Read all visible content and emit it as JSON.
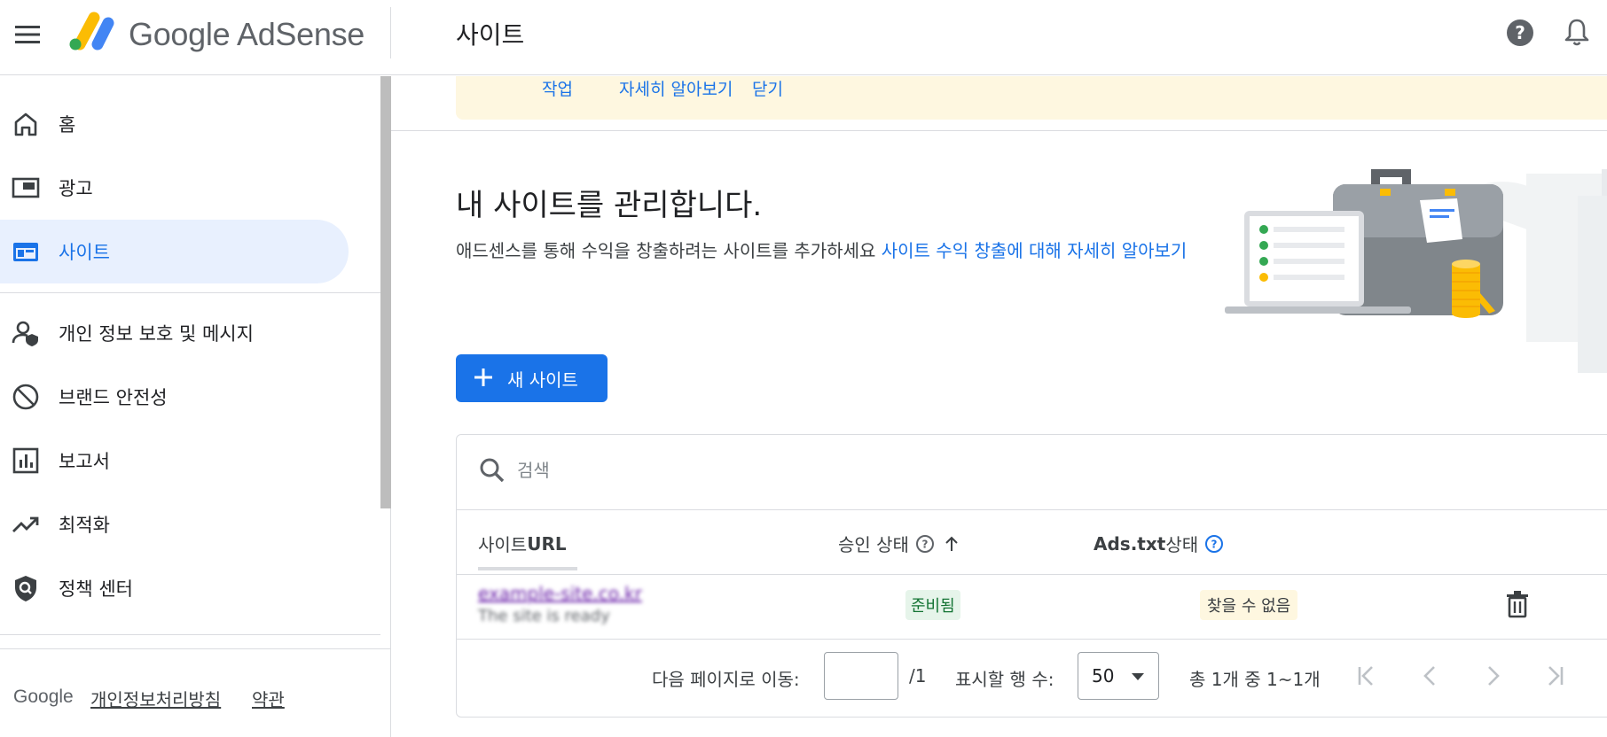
{
  "app": {
    "logo_text": "Google AdSense",
    "page_title": "사이트"
  },
  "topbar": {
    "menu_icon": "menu-icon",
    "help_icon": "help-icon",
    "notifications_icon": "bell-icon"
  },
  "sidebar": {
    "items": [
      {
        "label": "홈",
        "icon": "home-icon"
      },
      {
        "label": "광고",
        "icon": "ads-icon"
      },
      {
        "label": "사이트",
        "icon": "sites-icon",
        "active": true
      },
      {
        "label": "개인 정보 보호 및 메시지",
        "icon": "privacy-icon"
      },
      {
        "label": "브랜드 안전성",
        "icon": "block-icon"
      },
      {
        "label": "보고서",
        "icon": "reports-icon"
      },
      {
        "label": "최적화",
        "icon": "trending-up-icon"
      },
      {
        "label": "정책 센터",
        "icon": "policy-icon"
      }
    ],
    "footer": {
      "brand": "Google",
      "privacy": "개인정보처리방침",
      "terms": "약관"
    }
  },
  "banner": {
    "action": "작업",
    "learn_more": "자세히 알아보기",
    "close": "닫기"
  },
  "main": {
    "heading": "내 사이트를 관리합니다.",
    "description": "애드센스를 통해 수익을 창출하려는 사이트를 추가하세요 ",
    "description_link": "사이트 수익 창출에 대해 자세히 알아보기",
    "new_site_button": "새 사이트"
  },
  "table": {
    "search_placeholder": "검색",
    "columns": {
      "site_url_prefix": "사이트 ",
      "site_url_bold": "URL",
      "approval": "승인 상태",
      "ads_txt_bold": "Ads.txt",
      "ads_txt_suffix": " 상태"
    },
    "rows": [
      {
        "site_url": "example-site.co.kr",
        "sub_text": "The site is ready",
        "approval_status": "준비됨",
        "ads_txt_status": "찾을 수 없음"
      }
    ],
    "pager": {
      "goto_label": "다음 페이지로 이동:",
      "page_value": "",
      "page_total": "/1",
      "rows_label": "표시할 행 수:",
      "rows_value": "50",
      "range_text": "총 1개 중 1~1개"
    }
  },
  "colors": {
    "accent": "#1a73e8",
    "active_bg": "#e8f0fe",
    "banner_bg": "#fef7e0",
    "ready_bg": "#e6f4ea",
    "ready_fg": "#137333"
  }
}
